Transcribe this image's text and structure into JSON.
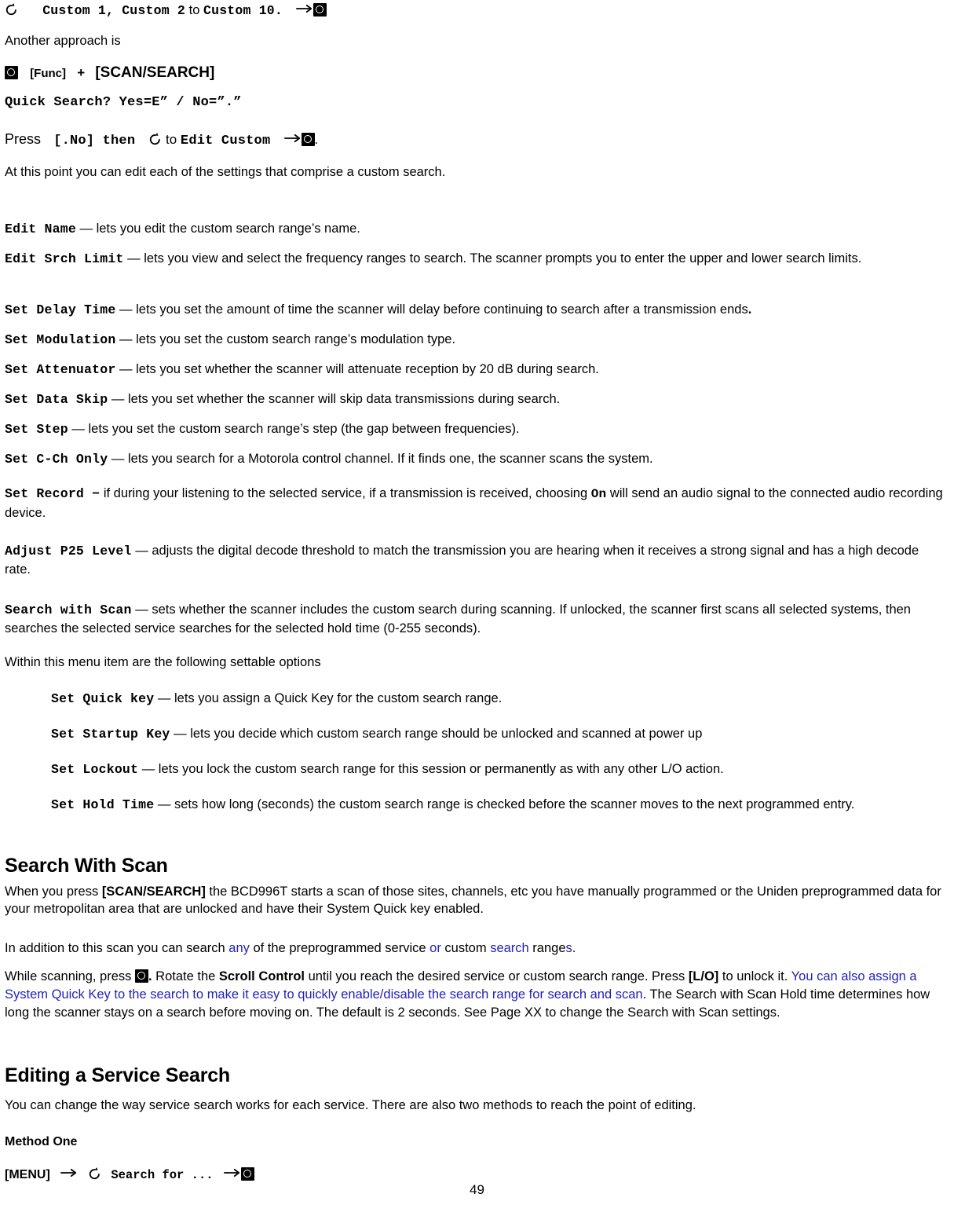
{
  "document": {
    "page_number": "49",
    "accent_blue": "#2222BB",
    "icons": {
      "rotate": "rotate-scroll-icon",
      "arrow": "right-arrow-icon",
      "enter_button": "e-enter-button-icon"
    }
  },
  "intro": {
    "line1_mono_a": "Custom 1, Custom 2",
    "line1_sans_to": " to ",
    "line1_mono_b": "Custom 10.",
    "another_approach": "Another approach is",
    "func_label": "[Func]",
    "plus": "+",
    "scan_search_label": "[SCAN/SEARCH]",
    "quick_search_prompt": "Quick Search? Yes=E” / No=”.”",
    "press_word": "Press",
    "press_key": "[.No] then",
    "press_to": " to ",
    "press_target": "Edit Custom",
    "press_period": ".",
    "at_this_point": "At this point you can edit each of the settings that comprise a custom search."
  },
  "settings": [
    {
      "term": "Edit Name",
      "dash": " — ",
      "desc": "lets you edit the custom search range’s name."
    },
    {
      "term": "Edit Srch Limit",
      "dash": " — ",
      "desc": "lets you view and select the frequency ranges to search. The scanner prompts you to enter the upper and lower search limits."
    },
    {
      "term": "Set Delay Time",
      "dash": " — ",
      "desc": "lets you set the amount of time the scanner will delay before continuing to search after a transmission ends",
      "desc_bold_tail": "."
    },
    {
      "term": "Set Modulation",
      "dash": " — ",
      "desc": "lets you set the custom search range’s modulation type."
    },
    {
      "term": "Set Attenuator",
      "dash": " — ",
      "desc": "lets you set whether the scanner will attenuate reception by 20 dB during search."
    },
    {
      "term": "Set Data Skip",
      "dash": " — ",
      "desc": "lets you set whether the scanner will skip data transmissions during search."
    },
    {
      "term": "Set Step",
      "dash": " — ",
      "desc": "lets you set the custom search range’s step (the gap between frequencies)."
    },
    {
      "term": "Set C-Ch Only",
      "dash": " — ",
      "desc": "lets you search for a Motorola control channel. If it finds one, the scanner scans the system."
    }
  ],
  "set_record": {
    "term": "Set Record −",
    "desc_part1": " if during your listening to the selected service, if a transmission is received, choosing ",
    "on_value": "On",
    "desc_part2": " will send an audio signal to the connected audio recording device."
  },
  "adjust_p25": {
    "term": "Adjust P25 Level",
    "dash": " — ",
    "desc": "adjusts the digital decode threshold to match the transmission you are hearing when it receives a strong signal and has a high decode rate."
  },
  "search_with_scan_item": {
    "term": "Search with Scan",
    "dash": " — ",
    "desc": "sets whether the scanner includes the custom search during scanning. If unlocked, the scanner first scans all selected systems, then searches the selected service searches for the selected hold time (0-255 seconds)."
  },
  "within_menu_intro": "Within this menu item are the following settable options",
  "sub_settings": [
    {
      "term": "Set Quick key",
      "dash": " — ",
      "desc": " lets you assign a Quick Key for the custom search range."
    },
    {
      "term": "Set Startup Key",
      "dash": " — ",
      "desc": "lets you decide which custom search range should be unlocked and scanned at power up"
    },
    {
      "term": "Set Lockout",
      "dash": " — ",
      "desc": "lets you lock the custom search range for this session or permanently as with any other L/O action."
    },
    {
      "term": "Set Hold Time",
      "dash": " — ",
      "desc": " sets how long (seconds) the custom search range is checked before the scanner moves to the next programmed entry."
    }
  ],
  "search_with_scan_section": {
    "heading": "Search With Scan",
    "para1_a": "When you press ",
    "para1_key": "[SCAN/SEARCH]",
    "para1_b": " the BCD996T starts a scan of those sites, channels, etc you have manually programmed or the Uniden preprogrammed data for your metropolitan area that are unlocked and have their System Quick key enabled.",
    "para2_a": "In addition to this scan you can search ",
    "para2_blue1": "any",
    "para2_b": " of the preprogrammed service ",
    "para2_blue2": "or",
    "para2_c": " custom ",
    "para2_blue3": "search",
    "para2_d": " range",
    "para2_blue4": "s",
    "para2_e": ".",
    "para3_a": "While scanning, press ",
    "para3_period": ".",
    "para3_b": "  Rotate the ",
    "para3_bold1": "Scroll Control",
    "para3_c": " until you reach the desired service or custom search range. Press ",
    "para3_bold2": "[L/O]",
    "para3_d": " to unlock it. ",
    "para3_blue": "You can also assign a System Quick Key to the search to make it easy to quickly enable/disable the search range for search and scan",
    "para3_e": ". The Search with Scan Hold time determines how long the scanner stays on a search before moving on. The default is 2 seconds. See Page XX to change the Search with Scan settings."
  },
  "editing_service_search": {
    "heading": "Editing a Service Search",
    "para": "You can change the way service search works for each service. There are also two methods to reach the point of editing.",
    "method_one": "Method One",
    "menu_key": "[MENU]",
    "search_for": "Search for ..."
  }
}
